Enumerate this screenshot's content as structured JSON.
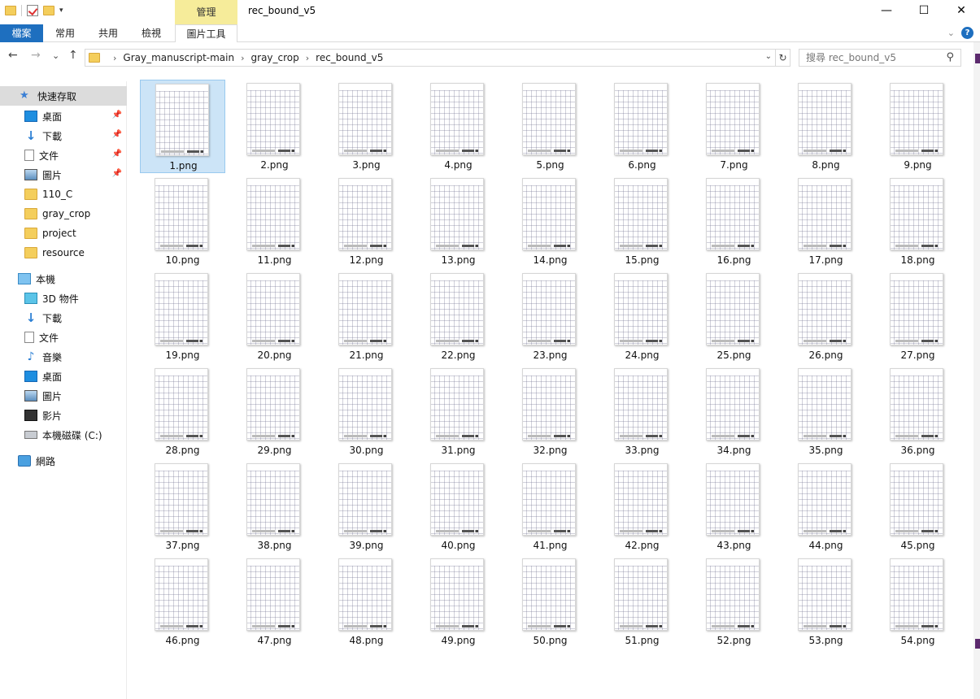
{
  "window": {
    "title": "rec_bound_v5",
    "manage_tab": "管理",
    "minimize": "—",
    "maximize": "☐",
    "close": "✕"
  },
  "ribbon": {
    "tabs": [
      {
        "label": "檔案"
      },
      {
        "label": "常用"
      },
      {
        "label": "共用"
      },
      {
        "label": "檢視"
      },
      {
        "label": "圖片工具"
      }
    ],
    "help": "?"
  },
  "nav": {
    "back": "←",
    "forward": "→",
    "recent": "⌄",
    "up": "↑",
    "breadcrumb": [
      "Gray_manuscript-main",
      "gray_crop",
      "rec_bound_v5"
    ],
    "search_placeholder": "搜尋 rec_bound_v5"
  },
  "sidebar": {
    "items": [
      {
        "label": "快速存取",
        "icon": "star-icon",
        "pinned": false,
        "selected": true
      },
      {
        "label": "桌面",
        "icon": "desktop-icon",
        "pinned": true
      },
      {
        "label": "下載",
        "icon": "download-icon",
        "pinned": true
      },
      {
        "label": "文件",
        "icon": "document-icon",
        "pinned": true
      },
      {
        "label": "圖片",
        "icon": "picture-icon",
        "pinned": true
      },
      {
        "label": "110_C",
        "icon": "folder-icon"
      },
      {
        "label": "gray_crop",
        "icon": "folder-icon"
      },
      {
        "label": "project",
        "icon": "folder-icon"
      },
      {
        "label": "resource",
        "icon": "folder-icon"
      },
      {
        "label": "本機",
        "icon": "pc-icon"
      },
      {
        "label": "3D 物件",
        "icon": "3d-objects-icon"
      },
      {
        "label": "下載",
        "icon": "download-icon"
      },
      {
        "label": "文件",
        "icon": "document-icon"
      },
      {
        "label": "音樂",
        "icon": "music-icon"
      },
      {
        "label": "桌面",
        "icon": "desktop-icon"
      },
      {
        "label": "圖片",
        "icon": "picture-icon"
      },
      {
        "label": "影片",
        "icon": "video-icon"
      },
      {
        "label": "本機磁碟 (C:)",
        "icon": "drive-icon"
      },
      {
        "label": "網路",
        "icon": "network-icon"
      }
    ]
  },
  "files": [
    "1.png",
    "2.png",
    "3.png",
    "4.png",
    "5.png",
    "6.png",
    "7.png",
    "8.png",
    "9.png",
    "10.png",
    "11.png",
    "12.png",
    "13.png",
    "14.png",
    "15.png",
    "16.png",
    "17.png",
    "18.png",
    "19.png",
    "20.png",
    "21.png",
    "22.png",
    "23.png",
    "24.png",
    "25.png",
    "26.png",
    "27.png",
    "28.png",
    "29.png",
    "30.png",
    "31.png",
    "32.png",
    "33.png",
    "34.png",
    "35.png",
    "36.png",
    "37.png",
    "38.png",
    "39.png",
    "40.png",
    "41.png",
    "42.png",
    "43.png",
    "44.png",
    "45.png",
    "46.png",
    "47.png",
    "48.png",
    "49.png",
    "50.png",
    "51.png",
    "52.png",
    "53.png",
    "54.png"
  ],
  "selected_file": "1.png"
}
